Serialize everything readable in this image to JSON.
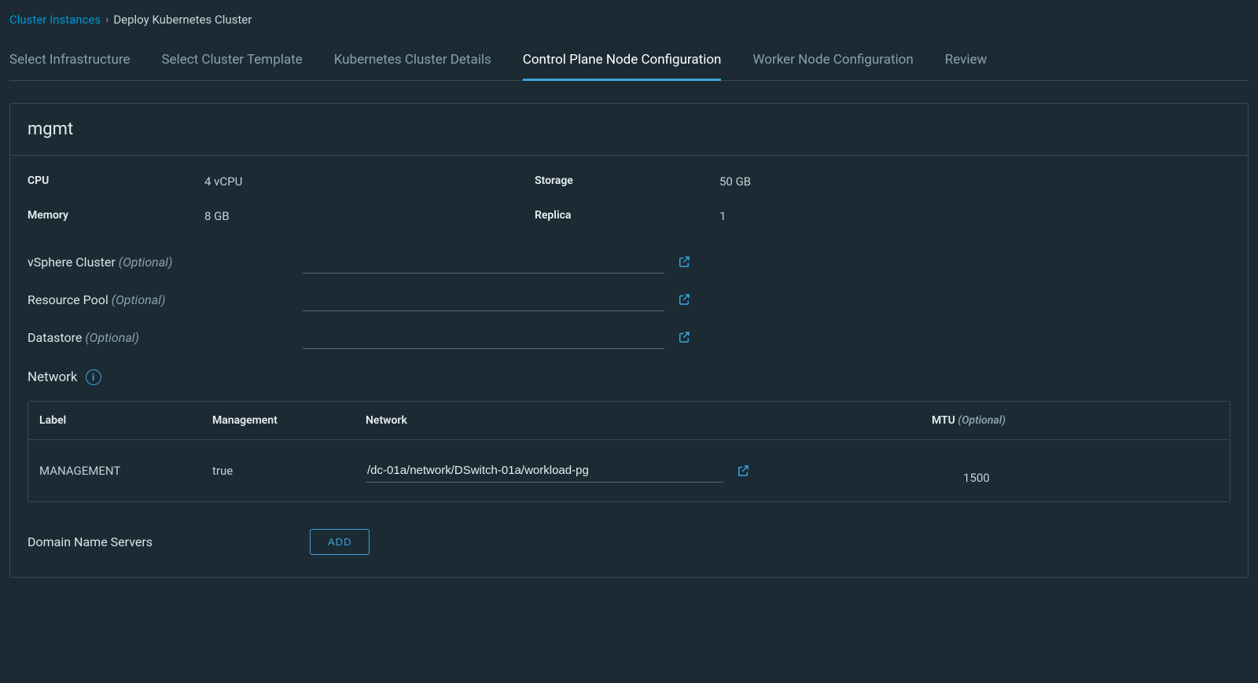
{
  "breadcrumb": {
    "parent": "Cluster Instances",
    "current": "Deploy Kubernetes Cluster"
  },
  "tabs": [
    {
      "label": "Select Infrastructure",
      "active": false
    },
    {
      "label": "Select Cluster Template",
      "active": false
    },
    {
      "label": "Kubernetes Cluster Details",
      "active": false
    },
    {
      "label": "Control Plane Node Configuration",
      "active": true
    },
    {
      "label": "Worker Node Configuration",
      "active": false
    },
    {
      "label": "Review",
      "active": false
    }
  ],
  "panel": {
    "title": "mgmt",
    "specs": {
      "cpu_label": "CPU",
      "cpu_value": "4 vCPU",
      "memory_label": "Memory",
      "memory_value": "8 GB",
      "storage_label": "Storage",
      "storage_value": "50 GB",
      "replica_label": "Replica",
      "replica_value": "1"
    },
    "optional_hint": "(Optional)",
    "vsphere_label": "vSphere Cluster",
    "vsphere_value": "",
    "resourcepool_label": "Resource Pool",
    "resourcepool_value": "",
    "datastore_label": "Datastore",
    "datastore_value": "",
    "network_label": "Network",
    "network_table": {
      "col_label": "Label",
      "col_mgmt": "Management",
      "col_net": "Network",
      "col_mtu": "MTU",
      "row": {
        "label": "MANAGEMENT",
        "management": "true",
        "network": "/dc-01a/network/DSwitch-01a/workload-pg",
        "mtu": "1500"
      }
    },
    "dns_label": "Domain Name Servers",
    "add_button": "ADD"
  }
}
